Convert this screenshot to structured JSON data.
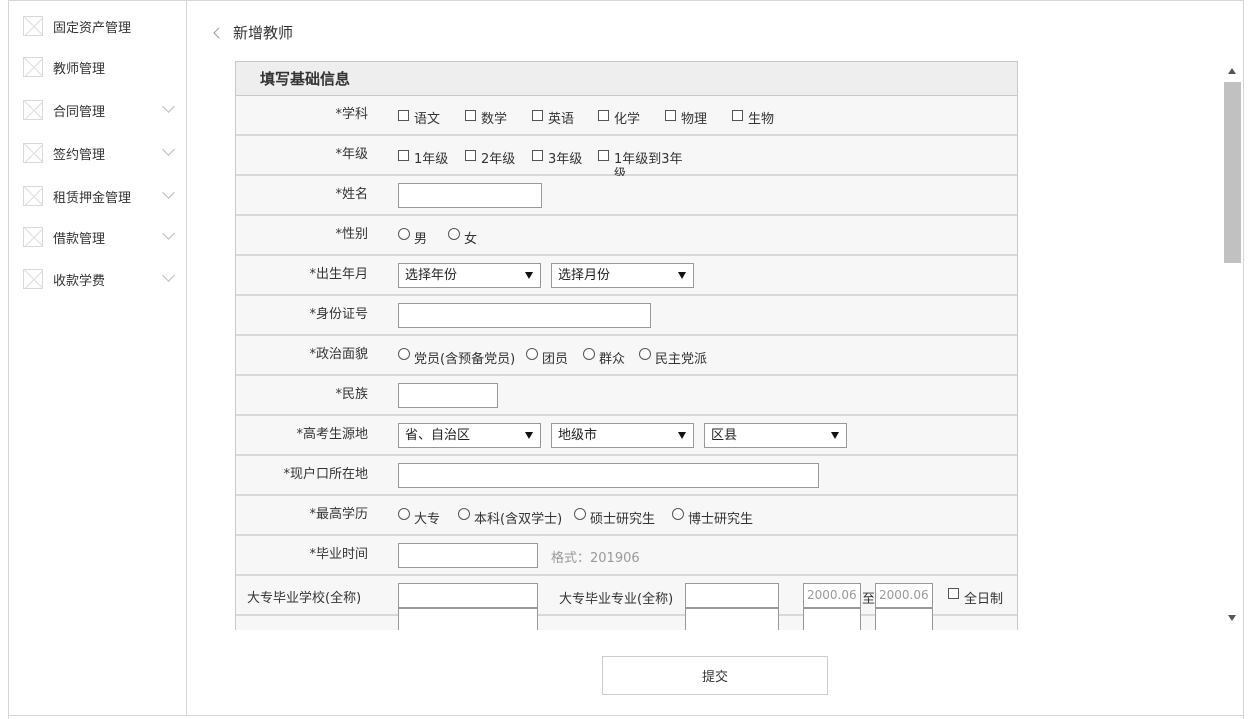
{
  "sidebar": {
    "items": [
      {
        "label": "固定资产管理",
        "icon": "image-placeholder-icon",
        "has_submenu": false
      },
      {
        "label": "教师管理",
        "icon": "image-placeholder-icon",
        "has_submenu": false
      },
      {
        "label": "合同管理",
        "icon": "image-placeholder-icon",
        "has_submenu": true
      },
      {
        "label": "签约管理",
        "icon": "image-placeholder-icon",
        "has_submenu": true
      },
      {
        "label": "租赁押金管理",
        "icon": "image-placeholder-icon",
        "has_submenu": true
      },
      {
        "label": "借款管理",
        "icon": "image-placeholder-icon",
        "has_submenu": true
      },
      {
        "label": "收款学费",
        "icon": "image-placeholder-icon",
        "has_submenu": true
      }
    ]
  },
  "header": {
    "back_title": "新增教师"
  },
  "form": {
    "section_title": "填写基础信息",
    "subject": {
      "label": "*学科",
      "options": [
        "语文",
        "数学",
        "英语",
        "化学",
        "物理",
        "生物"
      ]
    },
    "grade": {
      "label": "*年级",
      "options": [
        "1年级",
        "2年级",
        "3年级",
        "1年级到3年",
        "级"
      ]
    },
    "name": {
      "label": "*姓名",
      "value": ""
    },
    "gender": {
      "label": "*性别",
      "options": [
        "男",
        "女"
      ]
    },
    "birth": {
      "label": "*出生年月",
      "year_select": "选择年份",
      "month_select": "选择月份"
    },
    "id_number": {
      "label": "*身份证号",
      "value": ""
    },
    "political": {
      "label": "*政治面貌",
      "options": [
        "党员(含预备党员)",
        "团员",
        "群众",
        "民主党派"
      ]
    },
    "ethnicity": {
      "label": "*民族",
      "value": ""
    },
    "exam_origin": {
      "label": "*高考生源地",
      "province": "省、自治区",
      "city": "地级市",
      "county": "区县"
    },
    "hukou": {
      "label": "*现户口所在地",
      "value": ""
    },
    "education": {
      "label": "*最高学历",
      "options": [
        "大专",
        "本科(含双学士)",
        "硕士研究生",
        "博士研究生"
      ]
    },
    "graduation": {
      "label": "*毕业时间",
      "value": "",
      "hint": "格式：201906"
    },
    "college": {
      "school_label": "大专毕业学校(全称)",
      "major_label": "大专毕业专业(全称)",
      "from": "2000.06",
      "to_sep": "至",
      "to": "2000.06",
      "fulltime": "全日制"
    }
  },
  "submit_label": "提交"
}
